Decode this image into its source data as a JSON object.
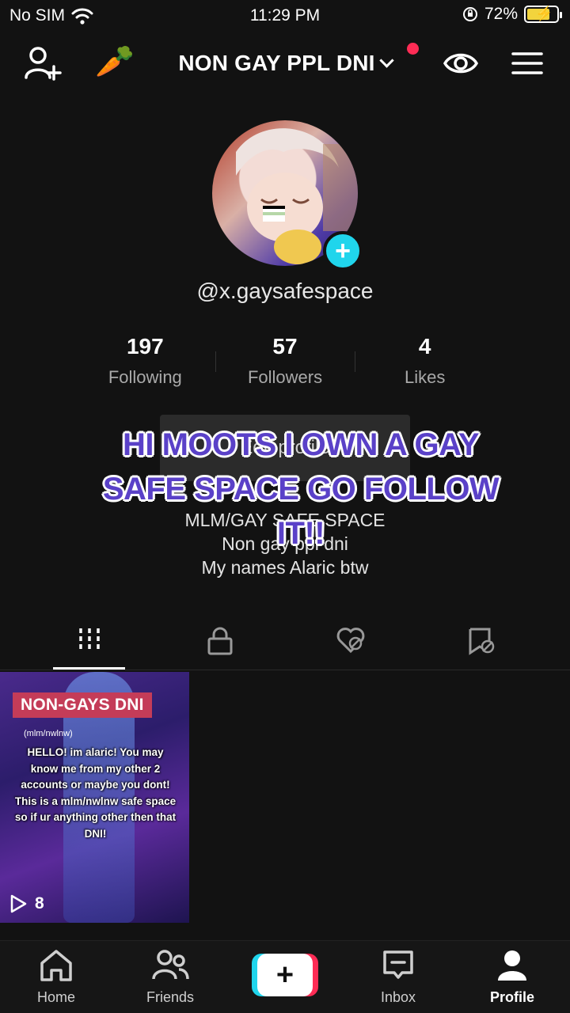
{
  "status_bar": {
    "carrier": "No SIM",
    "time": "11:29 PM",
    "battery": "72%"
  },
  "top_nav": {
    "title": "NON GAY PPL DNI",
    "carrot": "🥕"
  },
  "profile": {
    "handle": "@x.gaysafespace",
    "stats": [
      {
        "value": "197",
        "label": "Following"
      },
      {
        "value": "57",
        "label": "Followers"
      },
      {
        "value": "4",
        "label": "Likes"
      }
    ],
    "edit_button": "Edit profile",
    "bio": [
      "MLM/GAY SAFE SPACE",
      "Non gay ppl dni",
      "My names Alaric btw"
    ]
  },
  "overlay_caption": "HI MOOTS I OWN A GAY SAFE SPACE GO FOLLOW IT!!",
  "tabs": [
    {
      "icon": "grid-icon",
      "active": true
    },
    {
      "icon": "lock-icon",
      "active": false
    },
    {
      "icon": "liked-hidden-icon",
      "active": false
    },
    {
      "icon": "favorites-hidden-icon",
      "active": false
    }
  ],
  "videos": [
    {
      "title": "NON-GAYS DNI",
      "subtitle": "(mlm/nwlnw)",
      "text": "HELLO! im alaric! You may know me from my other 2 accounts or maybe you dont! This is a mlm/nwlnw safe space so if ur anything other then that DNI!",
      "views": "8"
    }
  ],
  "bottom_nav": {
    "home": "Home",
    "friends": "Friends",
    "inbox": "Inbox",
    "profile": "Profile"
  },
  "colors": {
    "accent_cyan": "#20d5ec",
    "accent_red": "#fe2c55",
    "overlay_text": "#5a41c8",
    "background": "#121212"
  }
}
